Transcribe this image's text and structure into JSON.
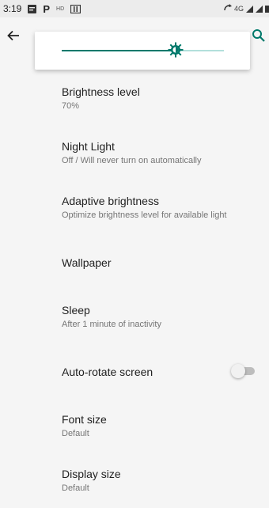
{
  "status_bar": {
    "time": "3:19",
    "network": "4G"
  },
  "brightness_slider": {
    "level": 0.7,
    "accent": "#00796b",
    "track_inactive": "#b2dfdb"
  },
  "settings": [
    {
      "title": "Brightness level",
      "subtitle": "70%"
    },
    {
      "title": "Night Light",
      "subtitle": "Off / Will never turn on automatically"
    },
    {
      "title": "Adaptive brightness",
      "subtitle": "Optimize brightness level for available light"
    },
    {
      "title": "Wallpaper",
      "subtitle": ""
    },
    {
      "title": "Sleep",
      "subtitle": "After 1 minute of inactivity"
    },
    {
      "title": "Auto-rotate screen",
      "subtitle": "",
      "toggle": false
    },
    {
      "title": "Font size",
      "subtitle": "Default"
    },
    {
      "title": "Display size",
      "subtitle": "Default"
    }
  ],
  "icons": {
    "back": "arrow-back-icon",
    "search": "search-icon",
    "brightness": "brightness-icon"
  }
}
